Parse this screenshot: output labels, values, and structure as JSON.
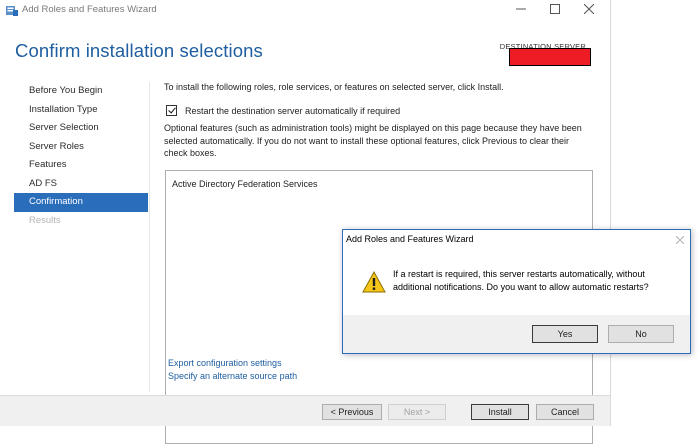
{
  "window": {
    "title": "Add Roles and Features Wizard"
  },
  "header": {
    "title": "Confirm installation selections",
    "destination_label": "DESTINATION SERVER"
  },
  "nav": {
    "items": [
      {
        "label": "Before You Begin",
        "state": "normal"
      },
      {
        "label": "Installation Type",
        "state": "normal"
      },
      {
        "label": "Server Selection",
        "state": "normal"
      },
      {
        "label": "Server Roles",
        "state": "normal"
      },
      {
        "label": "Features",
        "state": "normal"
      },
      {
        "label": "AD FS",
        "state": "normal"
      },
      {
        "label": "Confirmation",
        "state": "active"
      },
      {
        "label": "Results",
        "state": "disabled"
      }
    ]
  },
  "main": {
    "intro": "To install the following roles, role services, or features on selected server, click Install.",
    "restart_checkbox": {
      "label": "Restart the destination server automatically if required",
      "checked": true
    },
    "optional_note": "Optional features (such as administration tools) might be displayed on this page because they have been selected automatically. If you do not want to install these optional features, click Previous to clear their check boxes.",
    "features": [
      "Active Directory Federation Services"
    ],
    "links": {
      "export": "Export configuration settings",
      "alternate_source": "Specify an alternate source path"
    }
  },
  "footer": {
    "previous": "< Previous",
    "next": "Next >",
    "install": "Install",
    "cancel": "Cancel"
  },
  "dialog": {
    "title": "Add Roles and Features Wizard",
    "message": "If a restart is required, this server restarts automatically, without additional notifications. Do you want to allow automatic restarts?",
    "yes": "Yes",
    "no": "No",
    "icon": "warning-icon"
  },
  "colors": {
    "accent": "#2a6ebb",
    "title_blue": "#1f5ea0",
    "redaction": "#ee1c25"
  }
}
